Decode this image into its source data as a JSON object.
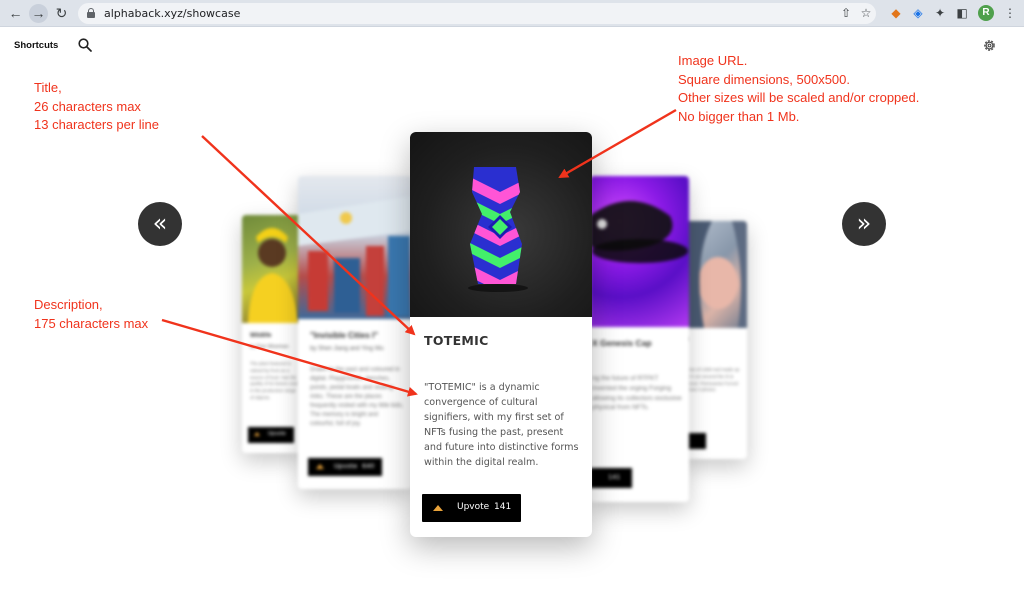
{
  "browser": {
    "url": "alphaback.xyz/showcase",
    "avatar_letter": "R"
  },
  "header": {
    "shortcuts_label": "Shortcuts"
  },
  "carousel": {
    "prev_label": "«",
    "next_label": "»",
    "main_card": {
      "title": "TOTEMIC",
      "description": "\"TOTEMIC\" is a dynamic convergence of cultural signifiers, with my first set of NFTs fusing the past, present and future into distinctive forms within the digital realm.",
      "upvote_label": "Upvote",
      "upvote_count": "141"
    },
    "left_card_1": {
      "title": "\"Invisible Cities I\"",
      "subtitle": "by Shen Jiang and Ying Wu",
      "description": "Drawn to the past and coloured in digital. Playgrounds, benches, ponds, pedal boats and skating rinks. These are the places frequently visited with my little kids. The memory is bright and colourful, full of joy.",
      "upvote_label": "Upvote",
      "upvote_count": "640"
    },
    "left_card_2": {
      "title": "Wildlife",
      "subtitle": "by Fion Wiseman",
      "description": "The plant featured is valued by front as a source of food. Hair the quality of its leaves used in the production range of objects.",
      "upvote_label": "Upvote"
    },
    "right_card_1": {
      "title": "X Genesis Cap",
      "description": "ng the future of RTFKT invented the orging Forging allowing its collectors exclusive physical from NFTs.",
      "upvote_count": "141"
    },
    "right_card_2": {
      "title": "t",
      "description": "ction of 1369 ned made up of 4 ure around the rk & Seoul. Pietrasanta Forced these 4 photos"
    }
  },
  "annotations": {
    "title_note": [
      "Title,",
      "26 characters max",
      "13 characters per line"
    ],
    "description_note": [
      "Description,",
      "175 characters max"
    ],
    "image_note": [
      "Image URL.",
      "Square dimensions, 500x500.",
      "Other sizes will be scaled and/or cropped.",
      "No bigger than 1 Mb."
    ],
    "color": "#f0331c"
  }
}
